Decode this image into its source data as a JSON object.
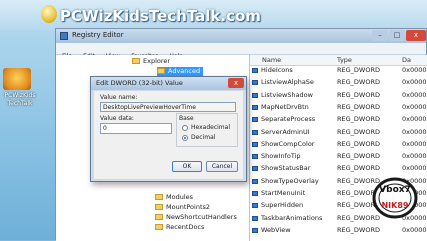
{
  "brand": {
    "text": "PCWizKidsTechTalk.com"
  },
  "desktop_icon": {
    "label_line1": "PCWizKids",
    "label_line2": "TechTalk"
  },
  "window": {
    "title": "Registry Editor",
    "menu": [
      "File",
      "Edit",
      "View",
      "Favorites",
      "Help"
    ],
    "controls": [
      "–",
      "□",
      "x"
    ]
  },
  "tree": {
    "top_items": [
      "Explorer",
      "Advanced"
    ],
    "bottom_items": [
      "Modules",
      "MountPoints2",
      "NewShortcutHandlers",
      "RecentDocs"
    ]
  },
  "list": {
    "headers": {
      "name": "Name",
      "type": "Type",
      "data": "Da"
    },
    "rows": [
      {
        "name": "HideIcons",
        "type": "REG_DWORD",
        "data": "0x0000"
      },
      {
        "name": "ListviewAlphaSe",
        "type": "REG_DWORD",
        "data": "0x0000"
      },
      {
        "name": "ListviewShadow",
        "type": "REG_DWORD",
        "data": "0x0000"
      },
      {
        "name": "MapNetDrvBtn",
        "type": "REG_DWORD",
        "data": "0x0000"
      },
      {
        "name": "SeparateProcess",
        "type": "REG_DWORD",
        "data": "0x0000"
      },
      {
        "name": "ServerAdminUI",
        "type": "REG_DWORD",
        "data": "0x0000"
      },
      {
        "name": "ShowCompColor",
        "type": "REG_DWORD",
        "data": "0x0000"
      },
      {
        "name": "ShowInfoTip",
        "type": "REG_DWORD",
        "data": "0x0000"
      },
      {
        "name": "ShowStatusBar",
        "type": "REG_DWORD",
        "data": "0x0000"
      },
      {
        "name": "ShowTypeOverlay",
        "type": "REG_DWORD",
        "data": "0x0000"
      },
      {
        "name": "StartMenuInit",
        "type": "REG_DWORD",
        "data": "0x0000"
      },
      {
        "name": "SuperHidden",
        "type": "REG_DWORD",
        "data": "0x0000"
      },
      {
        "name": "TaskbarAnimations",
        "type": "REG_DWORD",
        "data": "0x0000"
      },
      {
        "name": "WebView",
        "type": "REG_DWORD",
        "data": "0x0000"
      }
    ]
  },
  "dialog": {
    "title": "Edit DWORD (32-bit) Value",
    "value_name_label": "Value name:",
    "value_name": "DesktopLivePreviewHoverTime",
    "value_data_label": "Value data:",
    "value_data": "0",
    "base_label": "Base",
    "base_options": [
      "Hexadecimal",
      "Decimal"
    ],
    "selected_base": "Decimal",
    "ok_label": "OK",
    "cancel_label": "Cancel",
    "close_glyph": "x"
  },
  "watermark": {
    "top": "Vbox7",
    "bottom": "NIK89"
  },
  "colors": {
    "selection": "#3399ff",
    "title_gradient_top": "#c9dcee",
    "brand_text": "#ffffff"
  }
}
